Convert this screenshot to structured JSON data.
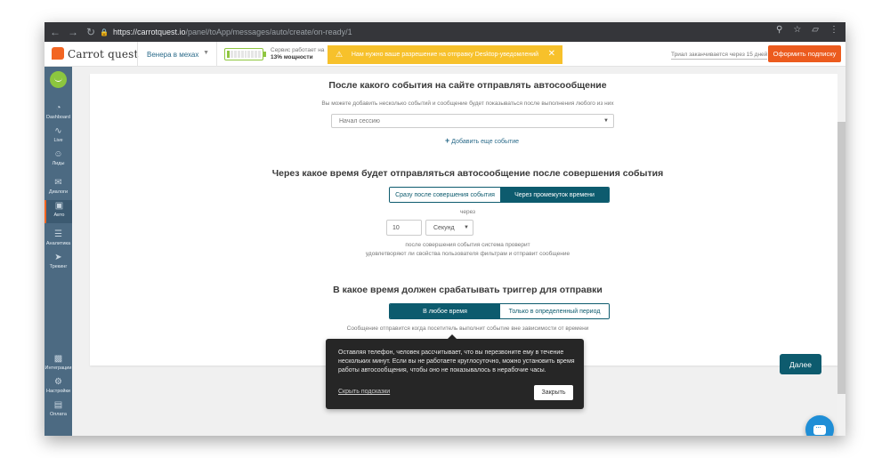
{
  "browser": {
    "url_host": "https://carrotquest.io",
    "url_path": "/panel/toApp/messages/auto/create/on-ready/1",
    "icons": [
      "back-icon",
      "forward-icon",
      "reload-icon",
      "lock-icon",
      "zoom-icon",
      "star-icon",
      "extension-icon",
      "menu-icon"
    ]
  },
  "header": {
    "logo_text": "Carrot quest",
    "app_name": "Венера в мехах",
    "service_line1": "Сервис работает на",
    "service_line2": "13% мощности",
    "service_power_percent": 13,
    "notice_text": "Нам нужно ваше разрешение на отправку Desktop-уведомлений",
    "trial_text": "Триал заканчивается через 15 дней",
    "subscribe_label": "Оформить подписку",
    "colors": {
      "accent": "#f26522",
      "notice": "#f7c12b",
      "primary": "#0d5b6e",
      "sidebar": "#4c6a82"
    }
  },
  "sidebar": {
    "items": [
      {
        "label": "Dashboard",
        "icon": "gauge-icon"
      },
      {
        "label": "Live",
        "icon": "pulse-icon"
      },
      {
        "label": "Лиды",
        "icon": "users-icon"
      },
      {
        "label": "Диалоги",
        "icon": "chat-icon"
      },
      {
        "label": "Авто",
        "icon": "monitor-icon",
        "active": true
      },
      {
        "label": "Аналитика",
        "icon": "funnel-icon"
      },
      {
        "label": "Трекинг",
        "icon": "cursor-icon"
      },
      {
        "label": "Интеграции",
        "icon": "puzzle-icon"
      },
      {
        "label": "Настройки",
        "icon": "gear-icon"
      },
      {
        "label": "Оплата",
        "icon": "card-icon"
      }
    ]
  },
  "main": {
    "event_section": {
      "title": "После какого события на сайте отправлять автосообщение",
      "hint": "Вы можете добавить несколько событий и сообщение будет показываться после выполнения любого из них",
      "selected_event": "Начал сессию",
      "add_event": "Добавить еще событие"
    },
    "timing_section": {
      "title": "Через какое время будет отправляться автосообщение после совершения события",
      "option_immediate": "Сразу после совершения события",
      "option_delay": "Через промежуток времени",
      "through": "через",
      "delay_value": "10",
      "delay_unit": "Секунд",
      "check_line1": "после совершения события система проверит",
      "check_line2": "удовлетворяют ли свойства пользователя фильтрам и отправит сообщение"
    },
    "trigger_section": {
      "title": "В какое время должен срабатывать триггер для отправки",
      "option_any": "В любое время",
      "option_period": "Только в определенный период",
      "note": "Сообщение отправится когда посетитель выполнит событие вне зависимости от времени"
    },
    "next_label": "Далее"
  },
  "tooltip": {
    "text": "Оставляя телефон, человек рассчитывает, что вы перезвоните ему в течение нескольких минут. Если вы не работаете круглосуточно, можно установить время работы автосообщения, чтобы оно не показывалось в нерабочие часы.",
    "skip_label": "Скрыть подсказки",
    "close_label": "Закрыть"
  }
}
